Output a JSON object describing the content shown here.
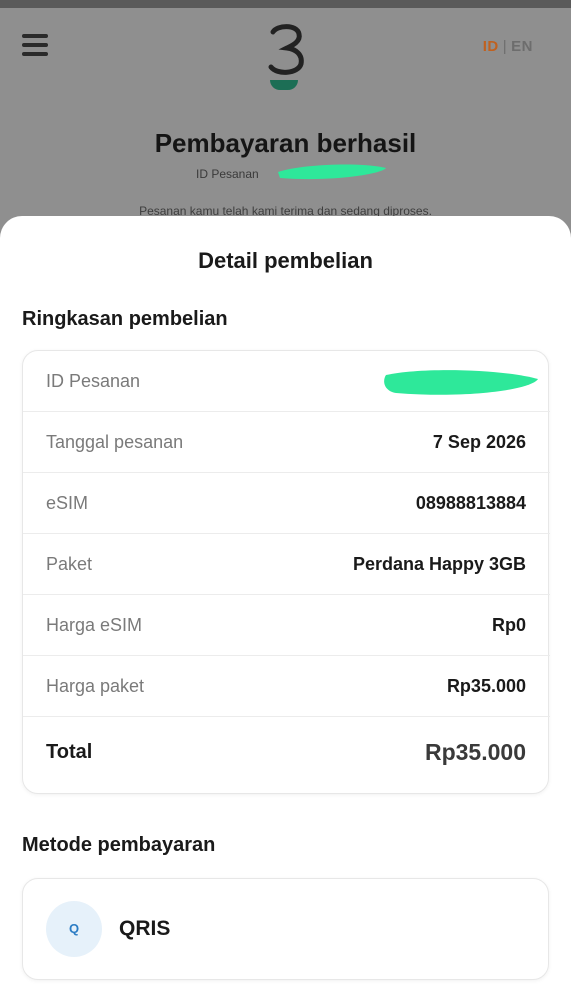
{
  "header": {
    "lang_id": "ID",
    "lang_separator": "|",
    "lang_en": "EN",
    "logo_icon": "three-logo-icon"
  },
  "background": {
    "title": "Pembayaran berhasil",
    "order_id_label": "ID Pesanan",
    "message": "Pesanan kamu telah kami terima dan sedang diproses."
  },
  "sheet": {
    "title": "Detail pembelian",
    "summary_title": "Ringkasan pembelian",
    "rows": [
      {
        "label": "ID Pesanan",
        "value": ""
      },
      {
        "label": "Tanggal pesanan",
        "value": "7 Sep 2026"
      },
      {
        "label": "eSIM",
        "value": "08988813884"
      },
      {
        "label": "Paket",
        "value": "Perdana Happy 3GB"
      },
      {
        "label": "Harga eSIM",
        "value": "Rp0"
      },
      {
        "label": "Harga paket",
        "value": "Rp35.000"
      }
    ],
    "total": {
      "label": "Total",
      "value": "Rp35.000"
    },
    "payment_title": "Metode pembayaran",
    "payment": {
      "icon_letter": "Q",
      "name": "QRIS"
    }
  },
  "colors": {
    "accent_orange": "#c0611f",
    "redaction_green": "#2ee89a",
    "qris_blue": "#2b7cc4"
  }
}
